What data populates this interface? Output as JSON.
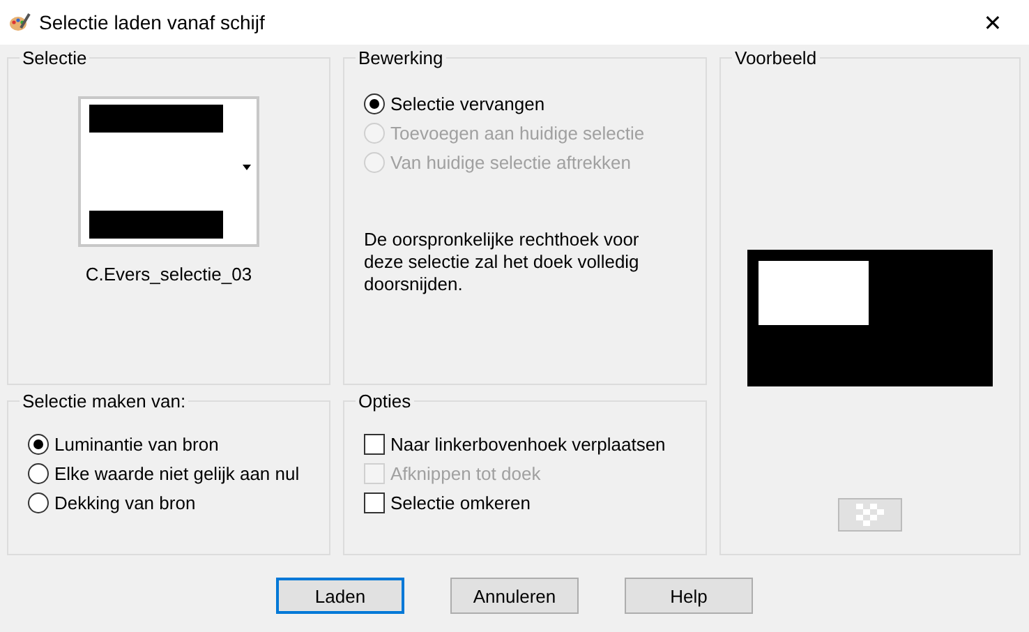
{
  "window": {
    "title": "Selectie laden vanaf schijf",
    "close": "✕"
  },
  "selection": {
    "title": "Selectie",
    "file_name": "C.Evers_selectie_03"
  },
  "operation": {
    "title": "Bewerking",
    "options": [
      {
        "label": "Selectie vervangen",
        "selected": true,
        "disabled": false
      },
      {
        "label": "Toevoegen aan huidige selectie",
        "selected": false,
        "disabled": true
      },
      {
        "label": "Van huidige selectie aftrekken",
        "selected": false,
        "disabled": true
      }
    ],
    "note": "De oorspronkelijke rechthoek voor deze selectie zal het doek volledig doorsnijden."
  },
  "preview": {
    "title": "Voorbeeld"
  },
  "source": {
    "title": "Selectie maken van:",
    "options": [
      {
        "label": "Luminantie van bron",
        "selected": true,
        "disabled": false
      },
      {
        "label": "Elke waarde niet gelijk aan nul",
        "selected": false,
        "disabled": false
      },
      {
        "label": "Dekking van bron",
        "selected": false,
        "disabled": false
      }
    ]
  },
  "options": {
    "title": "Opties",
    "items": [
      {
        "label": "Naar linkerbovenhoek verplaatsen",
        "checked": false,
        "disabled": false
      },
      {
        "label": "Afknippen tot doek",
        "checked": false,
        "disabled": true
      },
      {
        "label": "Selectie omkeren",
        "checked": false,
        "disabled": false
      }
    ]
  },
  "buttons": [
    {
      "label": "Laden",
      "default": true
    },
    {
      "label": "Annuleren",
      "default": false
    },
    {
      "label": "Help",
      "default": false
    }
  ]
}
